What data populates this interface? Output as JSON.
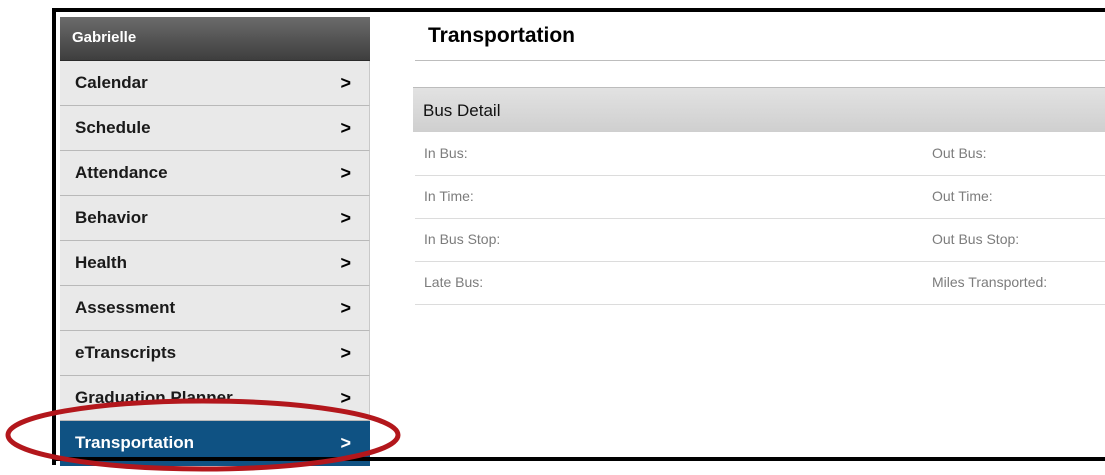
{
  "sidebar": {
    "header": "Gabrielle",
    "items": [
      {
        "label": "Calendar"
      },
      {
        "label": "Schedule"
      },
      {
        "label": "Attendance"
      },
      {
        "label": "Behavior"
      },
      {
        "label": "Health"
      },
      {
        "label": "Assessment"
      },
      {
        "label": "eTranscripts"
      },
      {
        "label": "Graduation Planner"
      },
      {
        "label": "Transportation",
        "active": true
      }
    ],
    "chevron": ">"
  },
  "main": {
    "title": "Transportation",
    "section": {
      "title": "Bus Detail",
      "rows": [
        {
          "left": "In Bus:",
          "right": "Out Bus:"
        },
        {
          "left": "In Time:",
          "right": "Out Time:"
        },
        {
          "left": "In Bus Stop:",
          "right": "Out Bus Stop:"
        },
        {
          "left": "Late Bus:",
          "right": "Miles Transported:"
        }
      ]
    }
  },
  "colors": {
    "active_item": "#0f5283",
    "annotation_outline": "#b3171c",
    "header_gradient": "#4a4a4a"
  },
  "icons": {
    "nav_chevron": "chevron-right-icon"
  }
}
